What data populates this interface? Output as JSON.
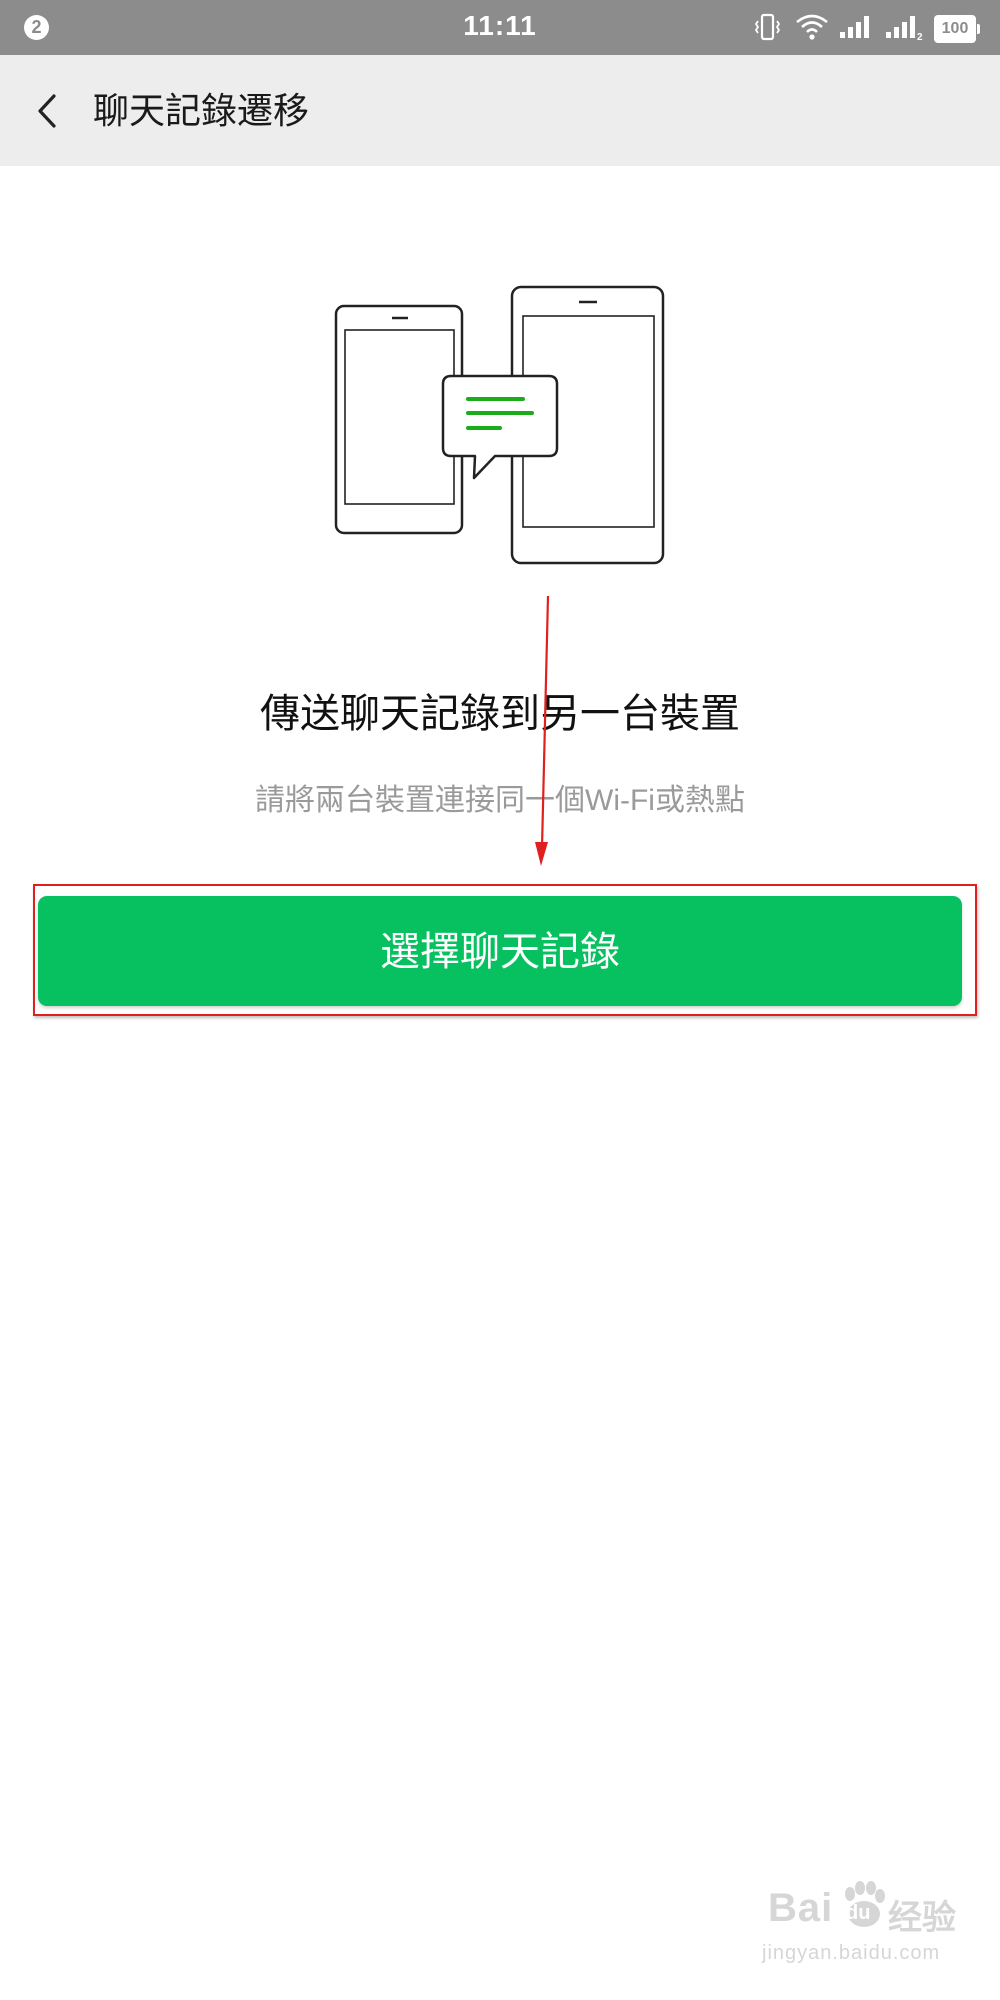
{
  "status_bar": {
    "notification_count": "2",
    "time": "11:11",
    "sim2_label": "2",
    "battery": "100",
    "icons": [
      "vibrate-icon",
      "wifi-icon",
      "signal-icon",
      "signal-sim2-icon",
      "battery-icon"
    ]
  },
  "header": {
    "back_icon": "chevron-left-icon",
    "title": "聊天記錄遷移"
  },
  "main": {
    "illustration": "phones-transfer-illustration",
    "heading": "傳送聊天記錄到另一台裝置",
    "subtitle": "請將兩台裝置連接同一個Wi-Fi或熱點",
    "primary_button_label": "選擇聊天記錄"
  },
  "annotation": {
    "highlight": "red-highlight-box",
    "pointer": "red-arrow-icon"
  },
  "watermark": {
    "brand_bai": "Bai",
    "brand_du": "du",
    "brand_jingyan": "经验",
    "url": "jingyan.baidu.com"
  },
  "colors": {
    "status_bar_bg": "#8c8c8c",
    "header_bg": "#ededed",
    "accent_green": "#07c160",
    "bubble_line_green": "#1aad19",
    "annotation_red": "#e0201e",
    "subtitle_gray": "#9a9a9a"
  }
}
